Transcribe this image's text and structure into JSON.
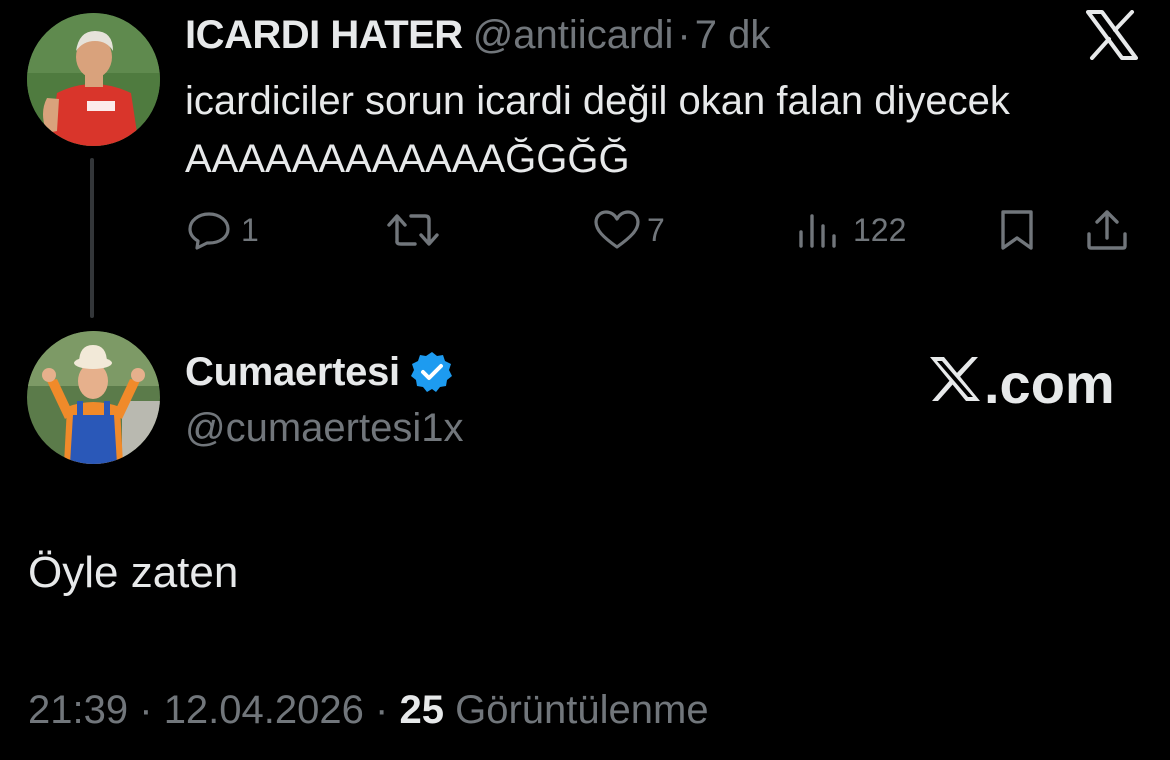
{
  "parent_tweet": {
    "author_name": "ICARDI HATER",
    "handle": "@antiicardi",
    "separator": "·",
    "time": "7 dk",
    "text_line1": "icardiciler sorun icardi değil okan falan diyecek",
    "text_line2": "AAAAAAAAAAAAĞGĞĞ",
    "actions": {
      "reply_count": "1",
      "like_count": "7",
      "views_count": "122"
    },
    "avatar_colors": {
      "bg": "#3f6b3a",
      "shirt": "#d9352b",
      "skin": "#d9a27c",
      "hair": "#e6e2da"
    }
  },
  "reply_tweet": {
    "author_name": "Cumaertesi",
    "handle": "@cumaertesi1x",
    "verified": true,
    "watermark": ".com",
    "body": "Öyle zaten",
    "meta": {
      "time": "21:39",
      "separator": "·",
      "date": "12.04.2026",
      "views_count": "25",
      "views_label": "Görüntülenme"
    },
    "avatar_colors": {
      "bg": "#5b7b4a",
      "overall": "#2a58b8",
      "shirt": "#f08a2a",
      "hat": "#f2e9d8"
    }
  },
  "colors": {
    "background": "#000000",
    "primary_text": "#e7e9ea",
    "secondary_text": "#71767b",
    "verified_blue": "#1d9bf0",
    "thread_line": "#333639"
  },
  "icons": [
    "x-logo-icon",
    "reply-icon",
    "retweet-icon",
    "like-icon",
    "views-icon",
    "bookmark-icon",
    "share-icon",
    "verified-badge-icon"
  ]
}
